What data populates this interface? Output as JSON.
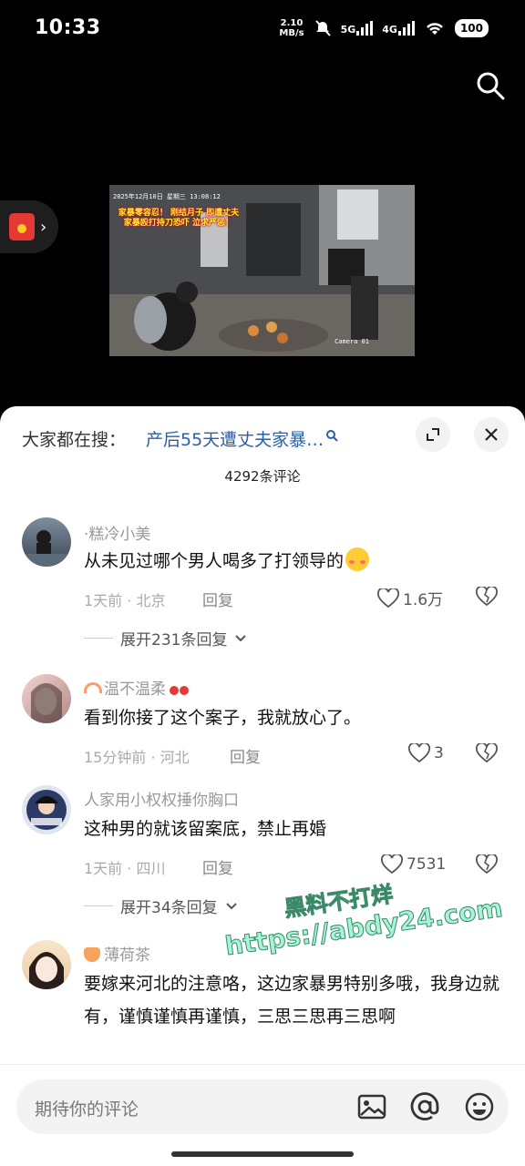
{
  "status": {
    "time": "10:33",
    "speed_value": "2.10",
    "speed_unit": "MB/s",
    "net1": "5G",
    "net2": "4G",
    "battery": "100"
  },
  "video": {
    "timestamp": "2025年12月10日 星期三 13:08:12",
    "caption": "家暴零容忍！ 刚结月子 即遭丈夫家暴殴打持刀恐吓 泣求严惩！",
    "camera": "Camera 01"
  },
  "sheet": {
    "hot_label": "大家都在搜：",
    "hot_term": "产后55天遭丈夫家暴…",
    "comment_count": "4292条评论"
  },
  "comments": [
    {
      "username": "·糕冷小美",
      "text": "从未见过哪个男人喝多了打领导的",
      "time": "1天前 · 北京",
      "reply": "回复",
      "likes": "1.6万",
      "expand": "展开231条回复"
    },
    {
      "username": "温不温柔",
      "text": "看到你接了这个案子，我就放心了。",
      "time": "15分钟前 · 河北",
      "reply": "回复",
      "likes": "3"
    },
    {
      "username": "人家用小权权捶你胸口",
      "text": "这种男的就该留案底，禁止再婚",
      "time": "1天前 · 四川",
      "reply": "回复",
      "likes": "7531",
      "expand": "展开34条回复"
    },
    {
      "username": "薄荷茶",
      "text": "要嫁来河北的注意咯，这边家暴男特别多哦，我身边就有，谨慎谨慎再谨慎，三思三思再三思啊"
    }
  ],
  "watermark": {
    "line1": "黑料不打烊",
    "line2": "https://abdy24.com"
  },
  "composer": {
    "placeholder": "期待你的评论"
  },
  "icons": [
    "search-icon",
    "share-icon",
    "close-icon",
    "heart-icon",
    "broken-heart-icon",
    "chevron-down-icon",
    "image-icon",
    "at-icon",
    "emoji-icon",
    "red-packet-icon"
  ]
}
